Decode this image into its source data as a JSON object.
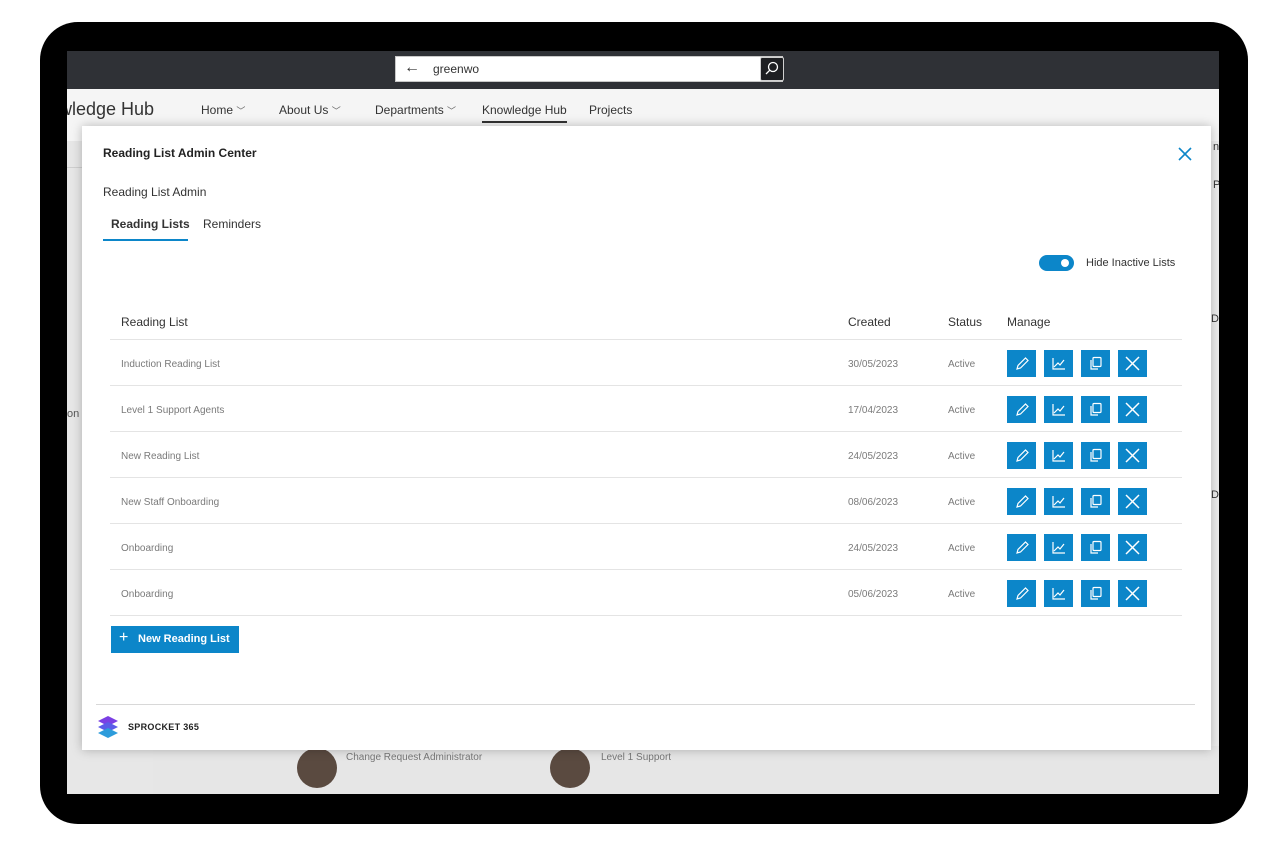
{
  "browser": {
    "search_value": "greenwo"
  },
  "nav": {
    "brand": "wledge Hub",
    "items": [
      {
        "label": "Home"
      },
      {
        "label": "About Us"
      },
      {
        "label": "Departments"
      },
      {
        "label": "Knowledge Hub"
      },
      {
        "label": "Projects"
      }
    ]
  },
  "background": {
    "left_text": "on",
    "right_letters": [
      "n",
      "P",
      "D",
      "D"
    ],
    "roles": [
      "Change Request Administrator",
      "Level 1 Support"
    ]
  },
  "modal": {
    "title": "Reading List Admin Center",
    "subtitle": "Reading List Admin",
    "tabs": [
      {
        "label": "Reading Lists"
      },
      {
        "label": "Reminders"
      }
    ],
    "toggle": {
      "label": "Hide Inactive Lists",
      "on": true
    },
    "table": {
      "headers": {
        "name": "Reading List",
        "created": "Created",
        "status": "Status",
        "manage": "Manage"
      },
      "rows": [
        {
          "name": "Induction Reading List",
          "created": "30/05/2023",
          "status": "Active"
        },
        {
          "name": "Level 1 Support Agents",
          "created": "17/04/2023",
          "status": "Active"
        },
        {
          "name": "New Reading List",
          "created": "24/05/2023",
          "status": "Active"
        },
        {
          "name": "New Staff Onboarding",
          "created": "08/06/2023",
          "status": "Active"
        },
        {
          "name": "Onboarding",
          "created": "24/05/2023",
          "status": "Active"
        },
        {
          "name": "Onboarding",
          "created": "05/06/2023",
          "status": "Active"
        }
      ]
    },
    "new_button": {
      "plus": "+",
      "label": "New Reading List"
    },
    "footer": {
      "logo_text": "SPROCKET 365"
    }
  },
  "colors": {
    "accent": "#0c86c9",
    "topbar": "#2f3136"
  },
  "icons": {
    "edit": "pencil-icon",
    "report": "chart-icon",
    "copy": "copy-icon",
    "delete": "close-icon"
  }
}
